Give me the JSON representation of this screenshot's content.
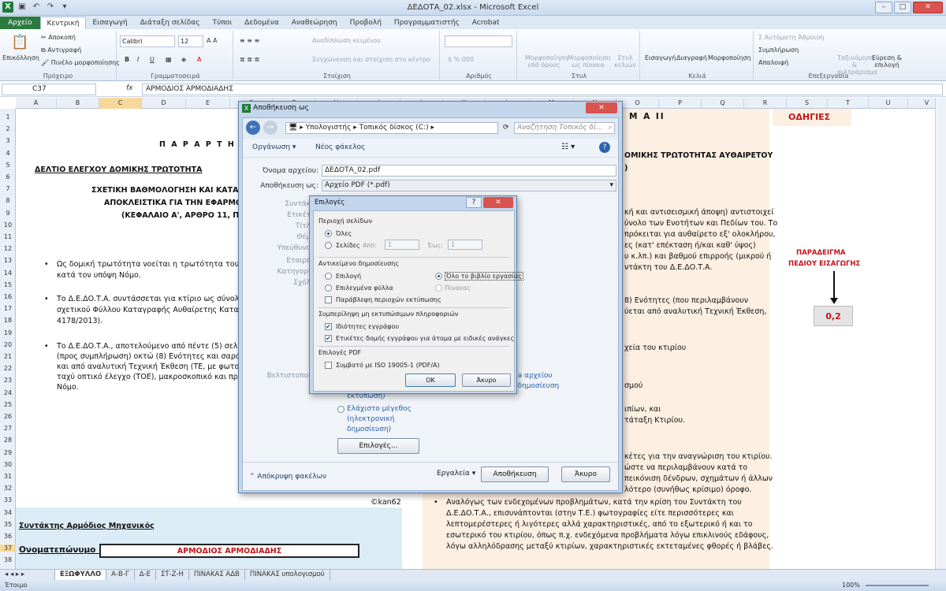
{
  "window": {
    "title": "ΔΕΔΟΤΑ_02.xlsx - Microsoft Excel"
  },
  "ribbon_tabs": [
    "Αρχείο",
    "Κεντρική",
    "Εισαγωγή",
    "Διάταξη σελίδας",
    "Τύποι",
    "Δεδομένα",
    "Αναθεώρηση",
    "Προβολή",
    "Προγραμματιστής",
    "Acrobat"
  ],
  "ribbon": {
    "clipboard": {
      "paste": "Επικόλληση",
      "cut": "Αποκοπή",
      "copy": "Αντιγραφή",
      "painter": "Πινέλο μορφοποίησης",
      "label": "Πρόχειρο"
    },
    "font": {
      "name": "Calibri",
      "size": "12",
      "label": "Γραμματοσειρά"
    },
    "alignment": {
      "wrap": "Αναδίπλωση κειμένου",
      "merge": "Συγχώνευση και στοίχιση στο κέντρο",
      "label": "Στοίχιση"
    },
    "number": {
      "label": "Αριθμός"
    },
    "styles": {
      "cond": "Μορφοποίηση υπό όρους",
      "table": "Μορφοποίηση ως πίνακα",
      "cell": "Στυλ κελιών",
      "label": "Στυλ"
    },
    "cells": {
      "insert": "Εισαγωγή",
      "delete": "Διαγραφή",
      "format": "Μορφοποίηση",
      "label": "Κελιά"
    },
    "editing": {
      "autosum": "Αυτόματη Άθροιση",
      "fill": "Συμπλήρωση",
      "clear": "Απαλοιφή",
      "sort": "Ταξινόμηση & φιλτράρισμα",
      "find": "Εύρεση & επιλογή",
      "label": "Επεξεργασία"
    }
  },
  "formula_bar": {
    "cell": "C37",
    "fx": "fx",
    "value": "ΑΡΜΟΔΙΟΣ ΑΡΜΟΔΙΑΔΗΣ"
  },
  "columns": [
    "A",
    "B",
    "C",
    "D",
    "E",
    "F",
    "G",
    "H",
    "I",
    "J",
    "K",
    "L",
    "M",
    "N",
    "O",
    "P",
    "Q",
    "R",
    "S",
    "T",
    "U",
    "V"
  ],
  "rows": [
    "1",
    "2",
    "3",
    "4",
    "5",
    "6",
    "7",
    "8",
    "9",
    "10",
    "11",
    "12",
    "13",
    "14",
    "15",
    "16",
    "17",
    "18",
    "19",
    "20",
    "21",
    "22",
    "23",
    "24",
    "25",
    "26",
    "27",
    "28",
    "29",
    "30",
    "31",
    "32",
    "33",
    "34",
    "35",
    "36",
    "37",
    "38"
  ],
  "sheet": {
    "title_left": "Π Α Ρ Α Ρ Τ Η Μ",
    "subtitle_left": "ΔΕΛΤΙΟ  ΕΛΕΓΧΟΥ  ΔΟΜΙΚΗΣ ΤΡΩΤΟΤΗΤΑ",
    "l6": "ΣΧΕΤΙΚΗ ΒΑΘΜΟΛΟΓΗΣΗ ΚΑΙ ΚΑΤΑΤ",
    "l7": "ΑΠΟΚΛΕΙΣΤΙΚΑ ΓΙΑ ΤΗΝ ΕΦΑΡΜΟΓ",
    "l8": "(ΚΕΦΑΛΑΙΟ Α', ΑΡΘΡΟ 11, ΠΑ",
    "b1a": "Ως δομική τρωτότητα νοείται η τρωτότητα του φέρο",
    "b1b": "κατά τον υπόψη Νόμο.",
    "b2a": "Το Δ.Ε.ΔΟ.Τ.Α. συντάσσεται για κτίριο ως σύνολο",
    "b2b": "σχετικού Φύλλου Καταγραφής Αυθαίρετης Κατασ",
    "b2c": "4178/2013).",
    "b3a": "Το Δ.Ε.ΔΟ.Τ.Α., αποτελούμενο από πέντε (5) σελ",
    "b3b": "(προς συμπλήρωση) οκτώ (8) Ενότητες και σαράν",
    "b3c": "και από αναλυτική Τεχνική Έκθεση (ΤΕ, με φωτογ",
    "b3d": "ταχύ οπτικό έλεγχο (ΤΟΕ), μακροσκοπικό και πρω",
    "b3e": "Νόμο.",
    "credit": "©kan62",
    "engineer": "Συντάκτης Αρμόδιος  Μηχανικός",
    "name_label": "Ονοματεπώνυμο :",
    "name_value": "ΑΡΜΟΔΙΟΣ ΑΡΜΟΔΙΑΔΗΣ",
    "title_right": "Π Α Ρ Α Ρ Τ Η Μ Α   ΙΙ",
    "odigies": "ΟΔΗΓΙΕΣ",
    "r5": "ΟΜΙΚΗΣ ΤΡΩΤΟΤΗΤΑΣ ΑΥΘΑΙΡΕΤΟΥ",
    "r6": ")",
    "r9": "κή και αντισεισμική άποψη) αντιστοιχεί",
    "r10": "ύνολο των Ενοτήτων και Πεδίων του. Το",
    "r11": "πρόκειται για αυθαίρετο εξ' ολοκλήρου,",
    "r12": "ες (κατ' επέκταση ή/και καθ' ύψος)",
    "r13": "υ κ.λπ.) και βαθμού επιρροής (μικρού ή",
    "r14": "ντάκτη του Δ.Ε.ΔΟ.Τ.Α.",
    "r16": "8) Ενότητες (που περιλαμβάνουν",
    "r17": "ύεται από αναλυτική Τεχνική Έκθεση,",
    "r20": "χεία του κτιρίου",
    "r24": "σμού",
    "r25": "ιπίων, και",
    "r26": "τάταξη Κτιρίου.",
    "r29": "κέτες για την αναγνώριση του κτιρίου.",
    "r30": "ώστε να περιλαμβάνουν κατά το",
    "r31": "πεικόνιση δένδρων, σχημάτων ή άλλων",
    "r32": "λότερο (συνήθως κρίσιμο) όροφο.",
    "r33": "Αναλόγως των ενδεχομένων προβλημάτων, κατά την κρίση του Συντάκτη του",
    "r34": "Δ.Ε.ΔΟ.Τ.Α., επισυνάπτονται (στην Τ.Ε.) φωτογραφίες είτε περισσότερες και",
    "r35": "λεπτομερέστερες ή λιγότερες αλλά χαρακτηριστικές, από το εξωτερικό ή και το",
    "r36": "εσωτερικό του κτιρίου, όπως π.χ. ενδεχόμενα προβλήματα λόγω επικλινούς εδάφους,",
    "r37": "λόγω αλληλόδρασης μεταξύ κτιρίων, χαρακτηριστικές εκτεταμένες φθορές ή βλάβες.",
    "example1": "ΠΑΡΑΔΕΙΓΜΑ",
    "example2": "ΠΕΔΙΟΥ ΕΙΣΑΓΩΓΗΣ",
    "example_value": "0,2"
  },
  "sheet_tabs": [
    "ΕΞΩΦΥΛΛΟ",
    "Α-Β-Γ",
    "Δ-Ε",
    "ΣΤ-Ζ-Η",
    "ΠΙΝΑΚΑΣ ΑΔΒ",
    "ΠΙΝΑΚΑΣ υπολογισμού"
  ],
  "status": {
    "ready": "Έτοιμο",
    "zoom": "100%"
  },
  "save_dialog": {
    "title": "Αποθήκευση ως",
    "path": [
      "Υπολογιστής",
      "Τοπικός δίσκος (C:)"
    ],
    "search_placeholder": "Αναζήτηση Τοπικός δί...",
    "organize": "Οργάνωση",
    "new_folder": "Νέος φάκελος",
    "filename_label": "Όνομα αρχείου:",
    "filename": "ΔΕΔΟΤΑ_02.pdf",
    "savetype_label": "Αποθήκευση ως:",
    "savetype": "Αρχείο PDF (*.pdf)",
    "hidden_labels": [
      "Συντάκ",
      "Ετικέτ",
      "Τίτλ",
      "Θέμ",
      "Υπεύθυνο",
      "Εταιρε",
      "Κατηγορί",
      "Σχόλ"
    ],
    "optimize_label": "Βελτιστοποί",
    "opt_standard_a": "ma αρχείου",
    "opt_standard_b": "ή δημοσίευση",
    "opt_standard_c": "εκτύπωση)",
    "opt_min": "Ελάχιστο μέγεθος",
    "opt_min2": "(ηλεκτρονική",
    "opt_min3": "δημοσίευση)",
    "options_btn": "Επιλογές...",
    "hide_folders": "Απόκρυψη φακέλων",
    "tools": "Εργαλεία",
    "save": "Αποθήκευση",
    "cancel": "Άκυρο"
  },
  "options_dialog": {
    "title": "Επιλογές",
    "page_range": "Περιοχή σελίδων",
    "all": "Όλες",
    "pages": "Σελίδες",
    "from": "Από:",
    "to": "Έως:",
    "from_val": "1",
    "to_val": "1",
    "publish_what": "Αντικείμενο δημοσίευσης",
    "selection": "Επιλογή",
    "whole_book": "Όλο το βιβλίο εργασίας",
    "selected_sheets": "Επιλεγμένα φύλλα",
    "table": "Πίνακας",
    "ignore_print_areas": "Παράβλεψη περιοχών εκτύπωσης",
    "non_print": "Συμπερίληψη μη εκτυπώσιμων πληροφοριών",
    "doc_props": "Ιδιότητες εγγράφου",
    "struct_tags": "Ετικέτες δομής εγγράφου για άτομα με ειδικές ανάγκες",
    "pdf_opts": "Επιλογές PDF",
    "iso": "Συμβατό με ISO 19005-1 (PDF/A)",
    "ok": "OK",
    "cancel": "Άκυρο"
  }
}
